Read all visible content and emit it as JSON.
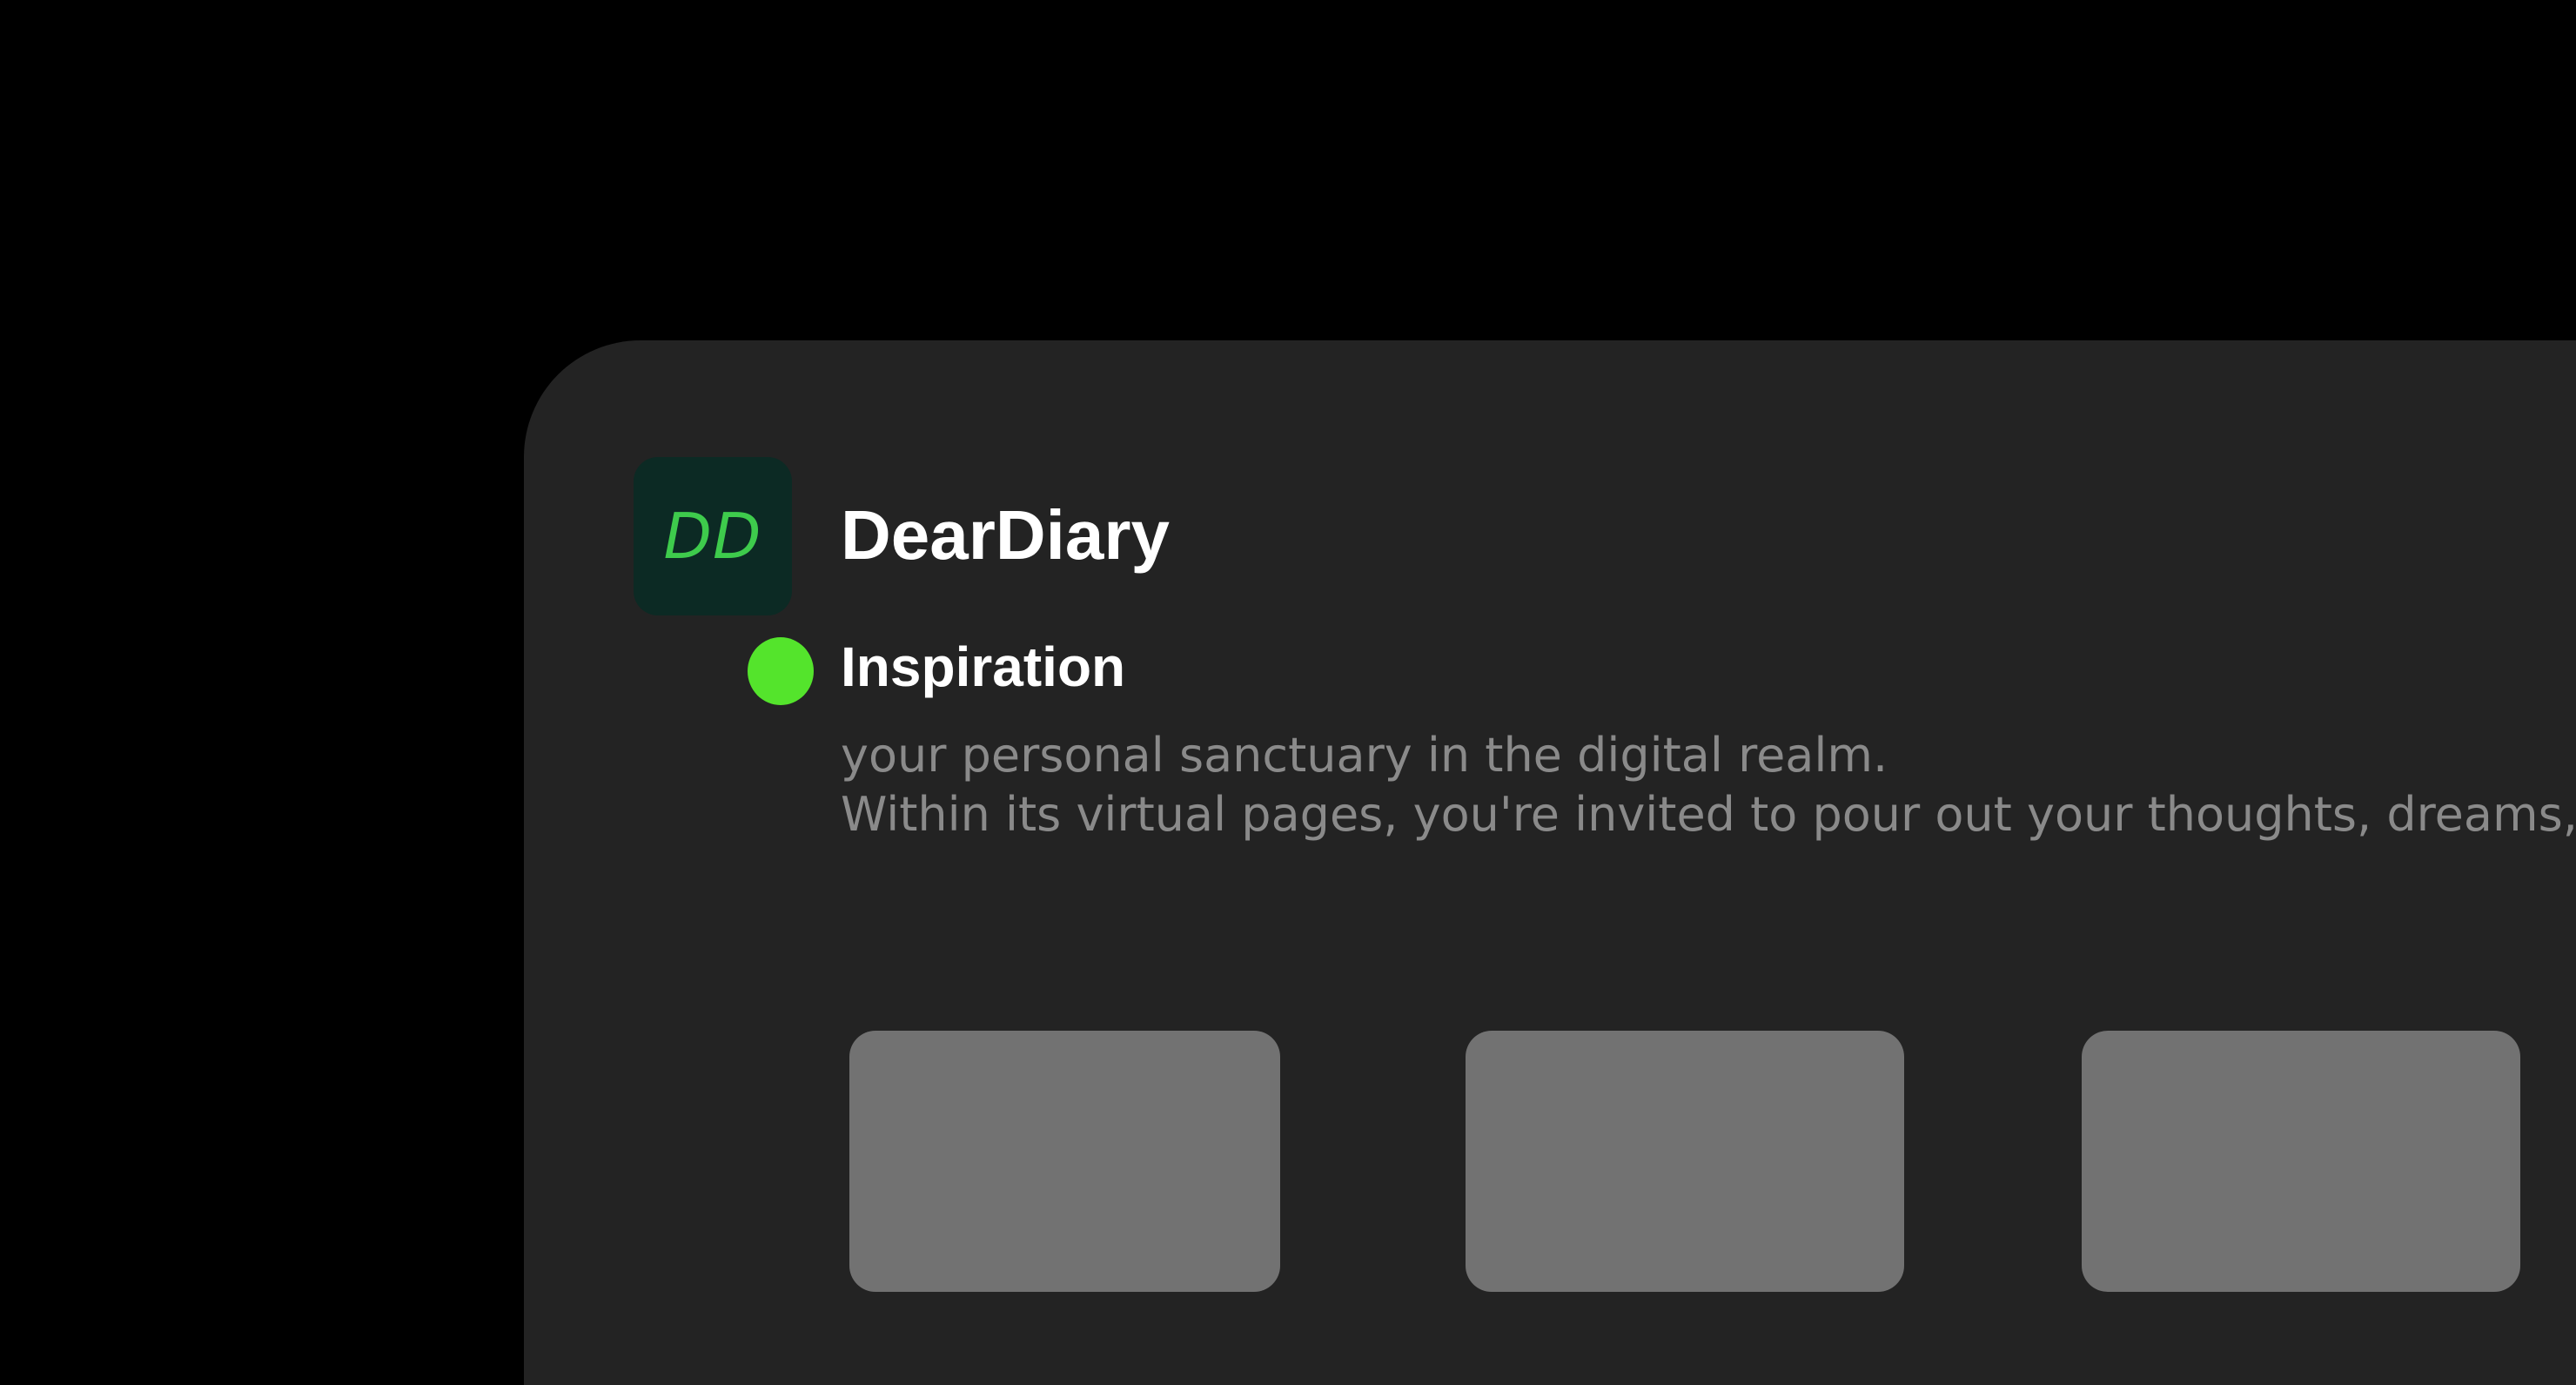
{
  "app": {
    "logo_text": "DD",
    "title": "DearDiary"
  },
  "section": {
    "title": "Inspiration",
    "status_color": "#54e42c",
    "description_lines": [
      "your personal sanctuary in the digital realm.",
      "Within its virtual pages, you're invited to pour out your thoughts, dreams,"
    ]
  },
  "cards": [
    {
      "label": ""
    },
    {
      "label": ""
    },
    {
      "label": ""
    }
  ],
  "colors": {
    "background": "#000000",
    "panel": "#232323",
    "logo_bg": "#0c2a24",
    "logo_text": "#3ecb4c",
    "card": "#727272",
    "muted_text": "#8a8a8a"
  }
}
